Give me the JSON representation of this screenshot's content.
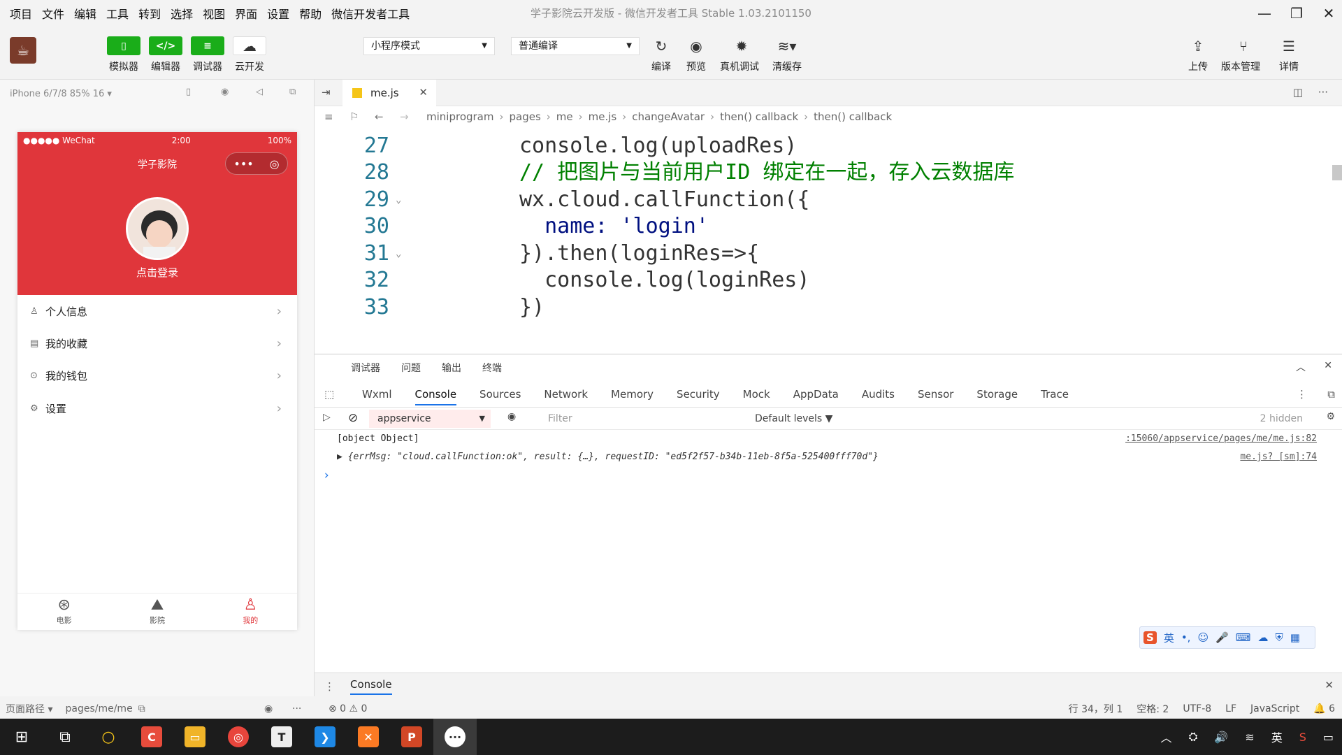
{
  "menubar": {
    "items": [
      "项目",
      "文件",
      "编辑",
      "工具",
      "转到",
      "选择",
      "视图",
      "界面",
      "设置",
      "帮助",
      "微信开发者工具"
    ],
    "window_title": "学子影院云开发版 - 微信开发者工具 Stable 1.03.2101150"
  },
  "toolbar": {
    "simulator": "模拟器",
    "editor": "编辑器",
    "debugger": "调试器",
    "cloud": "云开发",
    "mode_select": "小程序模式",
    "compile_select": "普通编译",
    "compile": "编译",
    "preview": "预览",
    "device_debug": "真机调试",
    "clear_cache": "清缓存",
    "upload": "上传",
    "version": "版本管理",
    "details": "详情"
  },
  "simulator": {
    "device": "iPhone 6/7/8 85% 16 ▾",
    "status_carrier": "●●●●● WeChat",
    "status_time": "2:00",
    "status_battery": "100%",
    "nav_title": "学子影院",
    "login_label": "点击登录",
    "menu": [
      {
        "icon": "user-icon",
        "label": "个人信息"
      },
      {
        "icon": "bookmark-icon",
        "label": "我的收藏"
      },
      {
        "icon": "wallet-icon",
        "label": "我的钱包"
      },
      {
        "icon": "settings-icon",
        "label": "设置"
      }
    ],
    "tabs": [
      {
        "icon": "film-icon",
        "label": "电影",
        "active": false
      },
      {
        "icon": "image-icon",
        "label": "影院",
        "active": false
      },
      {
        "icon": "user-icon",
        "label": "我的",
        "active": true
      }
    ],
    "accent": "#e0363b"
  },
  "sidebar_status": {
    "path_label": "页面路径 ▾",
    "path": "pages/me/me"
  },
  "editor": {
    "file_tab": "me.js",
    "breadcrumbs": [
      "miniprogram",
      "pages",
      "me",
      "me.js",
      "changeAvatar",
      "then() callback",
      "then() callback"
    ],
    "lines": [
      {
        "n": "27",
        "text": "console.log(uploadRes)"
      },
      {
        "n": "28",
        "text": "// 把图片与当前用户ID 绑定在一起，存入云数据库"
      },
      {
        "n": "29",
        "text": "wx.cloud.callFunction({"
      },
      {
        "n": "30",
        "text": "  name: 'login'"
      },
      {
        "n": "31",
        "text": "}).then(loginRes=>{"
      },
      {
        "n": "32",
        "text": "  console.log(loginRes)"
      },
      {
        "n": "33",
        "text": "})"
      }
    ]
  },
  "devtools": {
    "head_tabs": [
      "调试器",
      "问题",
      "输出",
      "终端"
    ],
    "tabs": [
      "Wxml",
      "Console",
      "Sources",
      "Network",
      "Memory",
      "Security",
      "Mock",
      "AppData",
      "Audits",
      "Sensor",
      "Storage",
      "Trace"
    ],
    "active_tab": "Console",
    "context": "appservice",
    "filter_placeholder": "Filter",
    "levels": "Default levels ▼",
    "hidden": "2 hidden",
    "log1": "[object Object]",
    "log1_src": ":15060/appservice/pages/me/me.js:82",
    "log2": "▶ {errMsg: \"cloud.callFunction:ok\", result: {…}, requestID: \"ed5f2f57-b34b-11eb-8f5a-525400fff70d\"}",
    "log2_src": "me.js? [sm]:74",
    "prompt": "›"
  },
  "bottom": {
    "console_tab": "Console",
    "errors": "⊗ 0 ⚠ 0",
    "position": "行 34，列 1",
    "spaces": "空格: 2",
    "encoding": "UTF-8",
    "eol": "LF",
    "language": "JavaScript",
    "notif": "🔔 6"
  },
  "taskbar": {
    "tray_lang": "英"
  },
  "ime": {
    "lang": "英"
  }
}
